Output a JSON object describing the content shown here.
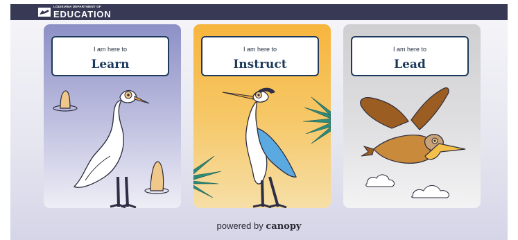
{
  "header": {
    "logo_small": "LOUISIANA DEPARTMENT OF",
    "logo_big": "EDUCATION"
  },
  "cards": [
    {
      "sub": "I am here to",
      "title": "Learn"
    },
    {
      "sub": "I am here to",
      "title": "Instruct"
    },
    {
      "sub": "I am here to",
      "title": "Lead"
    }
  ],
  "footer": {
    "prefix": "powered by",
    "brand": "canopy"
  }
}
